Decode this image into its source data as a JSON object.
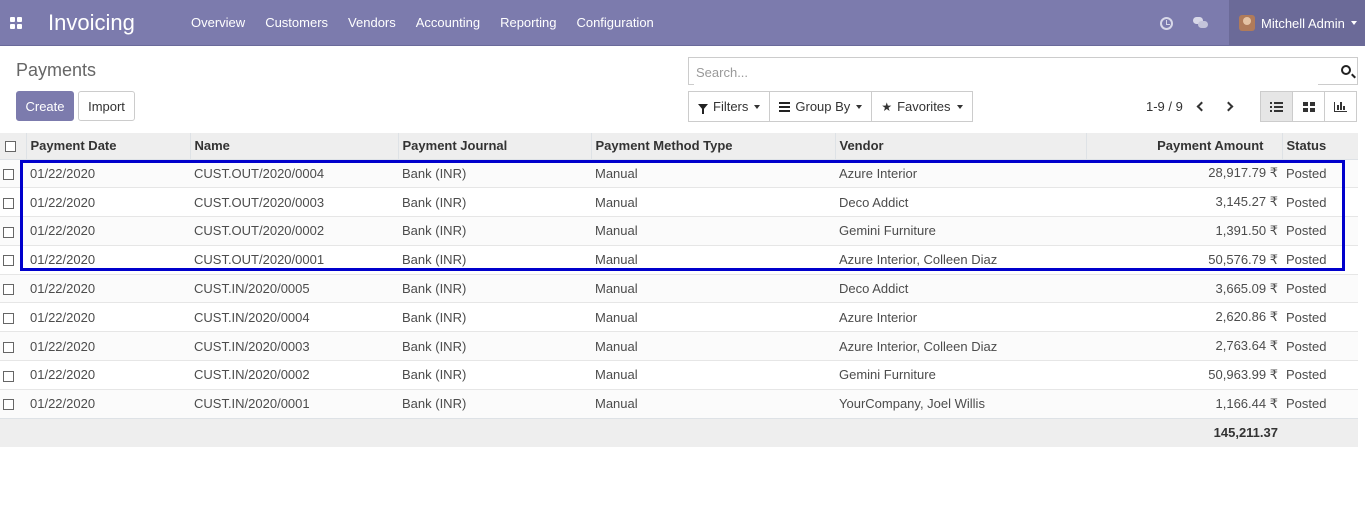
{
  "navbar": {
    "app_title": "Invoicing",
    "menu": [
      "Overview",
      "Customers",
      "Vendors",
      "Accounting",
      "Reporting",
      "Configuration"
    ],
    "user_name": "Mitchell Admin",
    "bg_color": "#7c7bad"
  },
  "control_panel": {
    "breadcrumb": "Payments",
    "create_label": "Create",
    "import_label": "Import",
    "search_placeholder": "Search...",
    "filters_label": "Filters",
    "group_by_label": "Group By",
    "favorites_label": "Favorites",
    "pager": "1-9 / 9"
  },
  "table": {
    "columns": [
      "Payment Date",
      "Name",
      "Payment Journal",
      "Payment Method Type",
      "Vendor",
      "Payment Amount",
      "Status"
    ],
    "rows": [
      [
        "01/22/2020",
        "CUST.OUT/2020/0004",
        "Bank (INR)",
        "Manual",
        "Azure Interior",
        "28,917.79 ₹",
        "Posted"
      ],
      [
        "01/22/2020",
        "CUST.OUT/2020/0003",
        "Bank (INR)",
        "Manual",
        "Deco Addict",
        "3,145.27 ₹",
        "Posted"
      ],
      [
        "01/22/2020",
        "CUST.OUT/2020/0002",
        "Bank (INR)",
        "Manual",
        "Gemini Furniture",
        "1,391.50 ₹",
        "Posted"
      ],
      [
        "01/22/2020",
        "CUST.OUT/2020/0001",
        "Bank (INR)",
        "Manual",
        "Azure Interior, Colleen Diaz",
        "50,576.79 ₹",
        "Posted"
      ],
      [
        "01/22/2020",
        "CUST.IN/2020/0005",
        "Bank (INR)",
        "Manual",
        "Deco Addict",
        "3,665.09 ₹",
        "Posted"
      ],
      [
        "01/22/2020",
        "CUST.IN/2020/0004",
        "Bank (INR)",
        "Manual",
        "Azure Interior",
        "2,620.86 ₹",
        "Posted"
      ],
      [
        "01/22/2020",
        "CUST.IN/2020/0003",
        "Bank (INR)",
        "Manual",
        "Azure Interior, Colleen Diaz",
        "2,763.64 ₹",
        "Posted"
      ],
      [
        "01/22/2020",
        "CUST.IN/2020/0002",
        "Bank (INR)",
        "Manual",
        "Gemini Furniture",
        "50,963.99 ₹",
        "Posted"
      ],
      [
        "01/22/2020",
        "CUST.IN/2020/0001",
        "Bank (INR)",
        "Manual",
        "YourCompany, Joel Willis",
        "1,166.44 ₹",
        "Posted"
      ]
    ],
    "total": "145,211.37"
  },
  "highlight_color": "#0000cc"
}
